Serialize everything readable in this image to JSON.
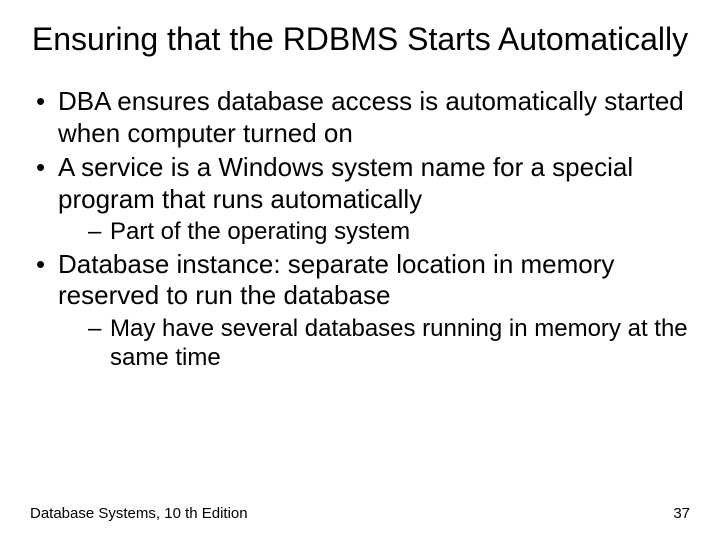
{
  "title": "Ensuring that the RDBMS Starts Automatically",
  "bullets": [
    {
      "text": "DBA ensures database access is automatically started when computer turned on",
      "sub": []
    },
    {
      "text": "A service is a Windows system name for a special program that runs automatically",
      "sub": [
        "Part of the operating system"
      ]
    },
    {
      "text": "Database instance: separate location in memory reserved to run the database",
      "sub": [
        "May have several databases running in memory at the same time"
      ]
    }
  ],
  "footer": {
    "left": "Database Systems, 10 th Edition",
    "right": "37"
  }
}
